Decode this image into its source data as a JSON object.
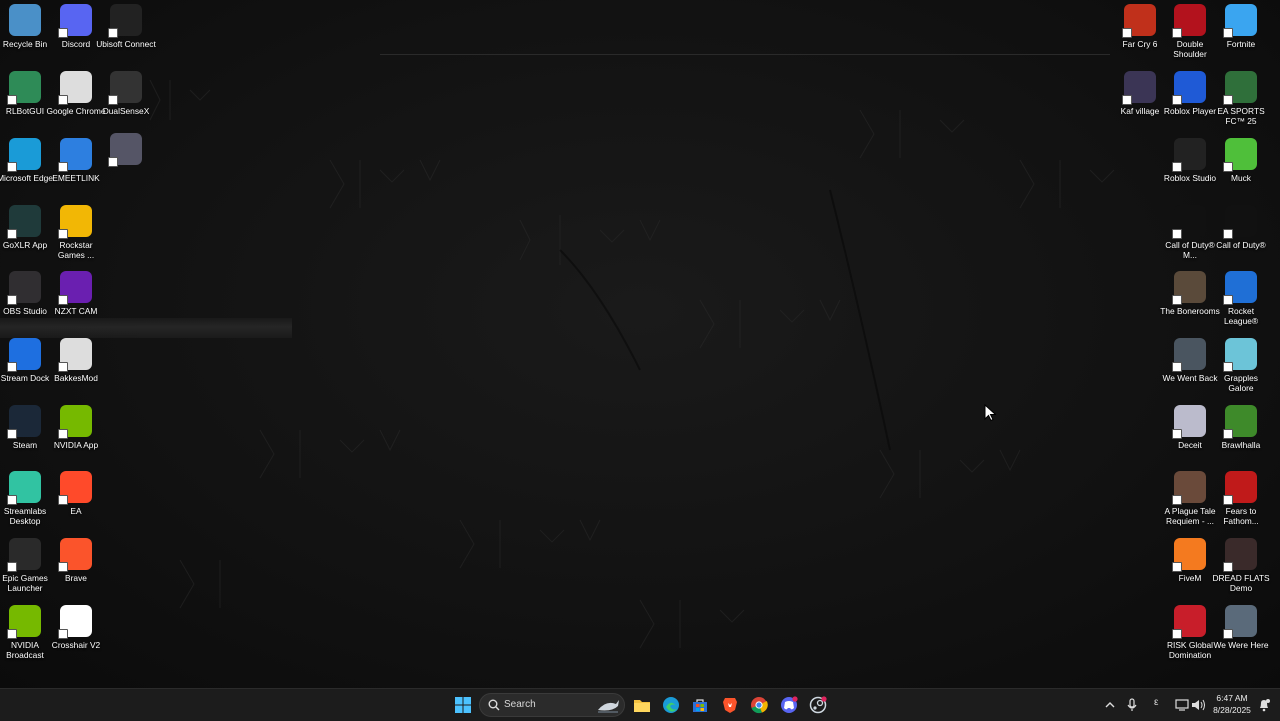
{
  "desktop": {
    "icons": [
      {
        "label": "Recycle Bin",
        "icon": "recycle-bin-icon",
        "color": "#4a90c8"
      },
      {
        "label": "Discord",
        "icon": "discord-icon",
        "color": "#5865f2"
      },
      {
        "label": "Ubisoft Connect",
        "icon": "ubisoft-icon",
        "color": "#222222"
      },
      {
        "label": "RLBotGUI",
        "icon": "rlbot-icon",
        "color": "#2e8b57"
      },
      {
        "label": "Google Chrome",
        "icon": "chrome-icon",
        "color": "#dddddd"
      },
      {
        "label": "DualSenseX",
        "icon": "dualsensex-icon",
        "color": "#333333"
      },
      {
        "label": "",
        "icon": "unnamed-app-icon",
        "color": "#555566"
      },
      {
        "label": "Microsoft Edge",
        "icon": "edge-icon",
        "color": "#1a9bd7"
      },
      {
        "label": "EMEETLINK",
        "icon": "emeetlink-icon",
        "color": "#2d7fe0"
      },
      {
        "label": "GoXLR App",
        "icon": "goxlr-icon",
        "color": "#1f3a3a"
      },
      {
        "label": "Rockstar Games ...",
        "icon": "rockstar-icon",
        "color": "#f2b705"
      },
      {
        "label": "OBS Studio",
        "icon": "obs-icon",
        "color": "#302e31"
      },
      {
        "label": "NZXT CAM",
        "icon": "nzxt-icon",
        "color": "#6a1fb0"
      },
      {
        "label": "Stream Dock",
        "icon": "stream-dock-icon",
        "color": "#1e6fe0"
      },
      {
        "label": "BakkesMod",
        "icon": "bakkesmod-icon",
        "color": "#dddddd"
      },
      {
        "label": "Steam",
        "icon": "steam-icon",
        "color": "#1b2838"
      },
      {
        "label": "NVIDIA App",
        "icon": "nvidia-icon",
        "color": "#76b900"
      },
      {
        "label": "Streamlabs Desktop",
        "icon": "streamlabs-icon",
        "color": "#31c3a2"
      },
      {
        "label": "EA",
        "icon": "ea-icon",
        "color": "#ff4a2a"
      },
      {
        "label": "Epic Games Launcher",
        "icon": "epic-games-icon",
        "color": "#2a2a2a"
      },
      {
        "label": "Brave",
        "icon": "brave-icon",
        "color": "#fb542b"
      },
      {
        "label": "NVIDIA Broadcast",
        "icon": "nvidia-broadcast-icon",
        "color": "#76b900"
      },
      {
        "label": "Crosshair V2",
        "icon": "crosshair-icon",
        "color": "#ffffff"
      },
      {
        "label": "Far Cry 6",
        "icon": "far-cry-icon",
        "color": "#c0301b"
      },
      {
        "label": "Double Shoulder",
        "icon": "double-shoulder-icon",
        "color": "#b3121d"
      },
      {
        "label": "Fortnite",
        "icon": "fortnite-icon",
        "color": "#3aa5f0"
      },
      {
        "label": "Kaf village",
        "icon": "kaf-village-icon",
        "color": "#3b3555"
      },
      {
        "label": "Roblox Player",
        "icon": "roblox-icon",
        "color": "#1f5ad6"
      },
      {
        "label": "EA SPORTS FC™ 25",
        "icon": "ea-fc-icon",
        "color": "#2f6f3a"
      },
      {
        "label": "Roblox Studio",
        "icon": "roblox-studio-icon",
        "color": "#222222"
      },
      {
        "label": "Muck",
        "icon": "muck-icon",
        "color": "#4fbf3a"
      },
      {
        "label": "Call of Duty® M...",
        "icon": "cod-mw-icon",
        "color": "#111111"
      },
      {
        "label": "Call of Duty®",
        "icon": "cod-icon",
        "color": "#111111"
      },
      {
        "label": "The Bonerooms",
        "icon": "bonerooms-icon",
        "color": "#5a4a3a"
      },
      {
        "label": "Rocket League®",
        "icon": "rocket-league-icon",
        "color": "#1f6fd6"
      },
      {
        "label": "We Went Back",
        "icon": "we-went-back-icon",
        "color": "#4a5560"
      },
      {
        "label": "Grapples Galore",
        "icon": "grapples-galore-icon",
        "color": "#6cc4d8"
      },
      {
        "label": "Deceit",
        "icon": "deceit-icon",
        "color": "#bbbbcc"
      },
      {
        "label": "Brawlhalla",
        "icon": "brawlhalla-icon",
        "color": "#3e8a2a"
      },
      {
        "label": "A Plague Tale Requiem - ...",
        "icon": "plague-tale-icon",
        "color": "#6a4a3a"
      },
      {
        "label": "Fears to Fathom...",
        "icon": "fears-to-fathom-icon",
        "color": "#c01a1a"
      },
      {
        "label": "FiveM",
        "icon": "fivem-icon",
        "color": "#f47a1f"
      },
      {
        "label": "DREAD FLATS Demo",
        "icon": "dread-flats-icon",
        "color": "#3a2a2a"
      },
      {
        "label": "RISK Global Domination",
        "icon": "risk-icon",
        "color": "#c81e2a"
      },
      {
        "label": "We Were Here",
        "icon": "we-were-here-icon",
        "color": "#5a6a7a"
      }
    ]
  },
  "taskbar": {
    "search_placeholder": "Search",
    "apps": [
      {
        "icon": "start-icon"
      },
      {
        "icon": "file-explorer-icon"
      },
      {
        "icon": "edge-icon"
      },
      {
        "icon": "microsoft-store-icon"
      },
      {
        "icon": "brave-icon"
      },
      {
        "icon": "chrome-icon"
      },
      {
        "icon": "discord-icon"
      },
      {
        "icon": "steam-icon"
      }
    ],
    "tray": {
      "keyboard_indicator": "ε",
      "time": "6:47 AM",
      "date": "8/28/2025"
    }
  }
}
